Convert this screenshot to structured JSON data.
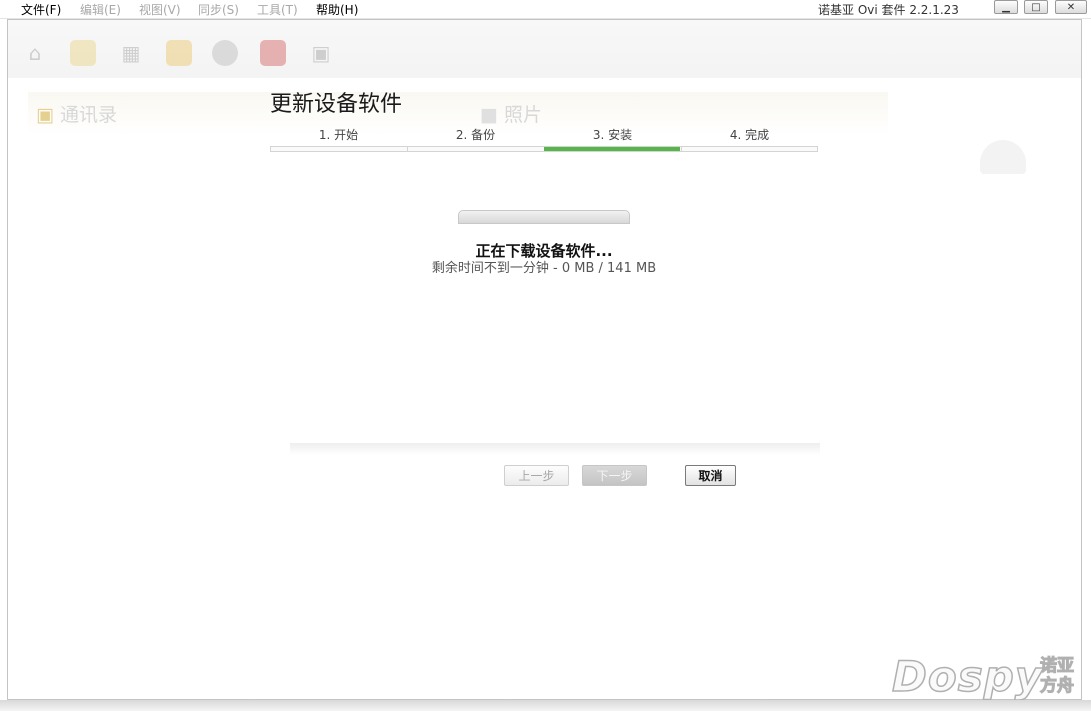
{
  "menubar": {
    "items": [
      {
        "label": "文件(F)",
        "enabled": true
      },
      {
        "label": "编辑(E)",
        "enabled": false
      },
      {
        "label": "视图(V)",
        "enabled": false
      },
      {
        "label": "同步(S)",
        "enabled": false
      },
      {
        "label": "工具(T)",
        "enabled": false
      },
      {
        "label": "帮助(H)",
        "enabled": true
      }
    ],
    "app_title": "诺基亚 Ovi 套件 2.2.1.23"
  },
  "window_controls": {
    "minimize_icon": "minimize-icon",
    "maximize_icon": "maximize-icon",
    "close_icon": "close-icon"
  },
  "background_app": {
    "tabs": [
      "通讯录",
      "照片"
    ]
  },
  "dialog": {
    "title": "更新设备软件",
    "steps": [
      "1. 开始",
      "2. 备份",
      "3. 安装",
      "4. 完成"
    ],
    "active_step": 3,
    "status": "正在下载设备软件...",
    "detail": "剩余时间不到一分钟 - 0 MB / 141 MB",
    "progress": 0,
    "accent_color": "#56b64a",
    "buttons": {
      "prev": "上一步",
      "next": "下一步",
      "cancel": "取消"
    }
  },
  "watermark": {
    "latin": "Dospy",
    "line1": "诺亚",
    "line2": "方舟"
  }
}
